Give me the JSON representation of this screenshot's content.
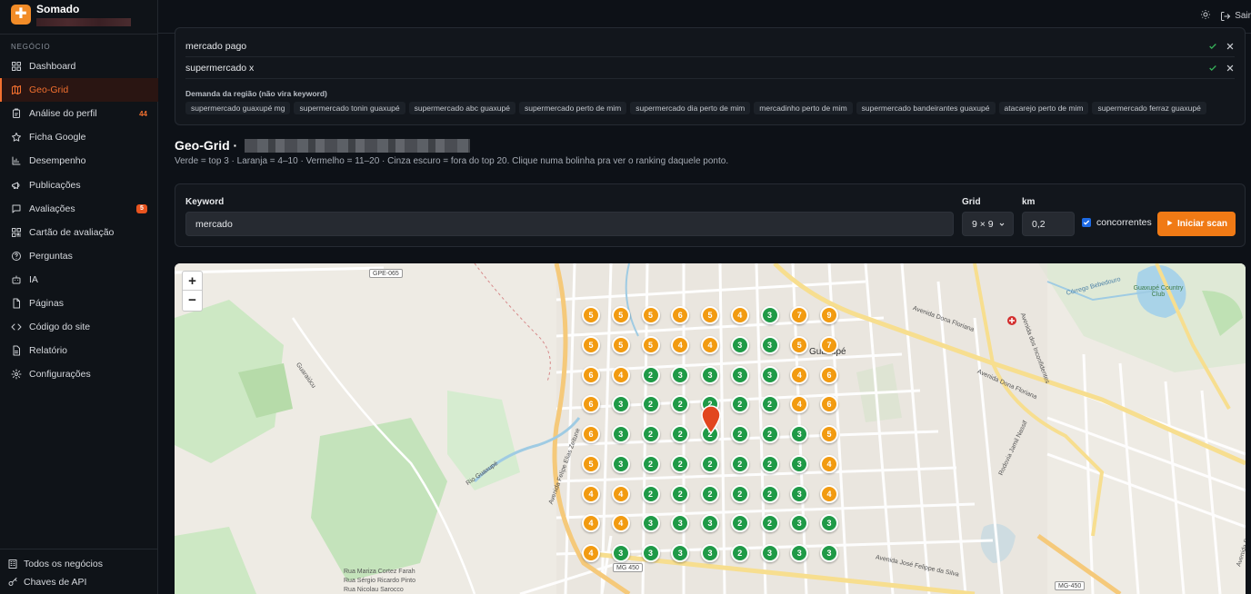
{
  "app": {
    "name": "Somado"
  },
  "sidebar": {
    "section": "NEGÓCIO",
    "items": [
      {
        "label": "Dashboard",
        "icon": "dashboard-icon"
      },
      {
        "label": "Geo-Grid",
        "icon": "map-icon",
        "active": true
      },
      {
        "label": "Análise do perfil",
        "icon": "clipboard-icon",
        "badge": "44"
      },
      {
        "label": "Ficha Google",
        "icon": "star-icon"
      },
      {
        "label": "Desempenho",
        "icon": "bar-chart-icon"
      },
      {
        "label": "Publicações",
        "icon": "megaphone-icon"
      },
      {
        "label": "Avaliações",
        "icon": "message-icon",
        "badge": "5"
      },
      {
        "label": "Cartão de avaliação",
        "icon": "qr-icon"
      },
      {
        "label": "Perguntas",
        "icon": "help-circle-icon"
      },
      {
        "label": "IA",
        "icon": "bot-icon"
      },
      {
        "label": "Páginas",
        "icon": "file-icon"
      },
      {
        "label": "Código do site",
        "icon": "code-icon"
      },
      {
        "label": "Relatório",
        "icon": "report-icon"
      },
      {
        "label": "Configurações",
        "icon": "gear-icon"
      }
    ],
    "bottom": [
      {
        "label": "Todos os negócios",
        "icon": "building-icon"
      },
      {
        "label": "Chaves de API",
        "icon": "key-icon"
      }
    ]
  },
  "topbar": {
    "logout": "Sair"
  },
  "keywords": {
    "rows": [
      "mercado pago",
      "supermercado x"
    ],
    "demand_title": "Demanda da região (não vira keyword)",
    "chips": [
      "supermercado guaxupé mg",
      "supermercado tonin guaxupé",
      "supermercado abc guaxupé",
      "supermercado perto de mim",
      "supermercado dia perto de mim",
      "mercadinho perto de mim",
      "supermercado bandeirantes guaxupé",
      "atacarejo perto de mim",
      "supermercado ferraz guaxupé"
    ]
  },
  "geogrid": {
    "title": "Geo-Grid ·",
    "description": "Verde = top 3 · Laranja = 4–10 · Vermelho = 11–20 · Cinza escuro = fora do top 20. Clique numa bolinha pra ver o ranking daquele ponto."
  },
  "form": {
    "keyword_label": "Keyword",
    "keyword_value": "mercado",
    "grid_label": "Grid",
    "grid_value": "9 × 9",
    "km_label": "km",
    "km_value": "0,2",
    "competitors_label": "concorrentes",
    "competitors_checked": true,
    "scan_button": "Iniciar scan"
  },
  "colors": {
    "accent": "#f2702f",
    "top3": "#1f9a47",
    "top10": "#f29b11"
  },
  "map": {
    "zoom_in": "+",
    "zoom_out": "−",
    "labels": {
      "gpe065": "GPE-065",
      "city": "Guaxupé",
      "av_dona_floriana": "Avenida Dona Floriana",
      "av_jose_felippe": "Avenida José Felippe da Silva",
      "mg450": "MG 450",
      "mg450b": "MG-450",
      "rio": "Rio Guaxupé",
      "rodovia": "Rodovia Jamil Nassif",
      "felipe": "Avenida Felipe Elias Zeitune",
      "country": "Guaxupé Country Club",
      "corrego": "Córrego Bebedouro",
      "guaraiucu": "Guaraiúcu",
      "incon": "Avenida dos Inconfidentes",
      "maria_cortez": "Rua Mariza Cortez Farah",
      "sergio": "Rua Sérgio Ricardo Pinto",
      "nicolau": "Rua Nicolau Sarocco"
    },
    "grid": [
      [
        5,
        5,
        5,
        6,
        5,
        4,
        3,
        7,
        9
      ],
      [
        5,
        5,
        5,
        4,
        4,
        3,
        3,
        5,
        7
      ],
      [
        6,
        4,
        2,
        3,
        3,
        3,
        3,
        4,
        6
      ],
      [
        6,
        3,
        2,
        2,
        2,
        2,
        2,
        4,
        6
      ],
      [
        6,
        3,
        2,
        2,
        2,
        2,
        2,
        3,
        5
      ],
      [
        5,
        3,
        2,
        2,
        2,
        2,
        2,
        3,
        4
      ],
      [
        4,
        4,
        2,
        2,
        2,
        2,
        2,
        3,
        4
      ],
      [
        4,
        4,
        3,
        3,
        3,
        2,
        2,
        3,
        3
      ],
      [
        4,
        3,
        3,
        3,
        3,
        2,
        3,
        3,
        3
      ]
    ]
  }
}
